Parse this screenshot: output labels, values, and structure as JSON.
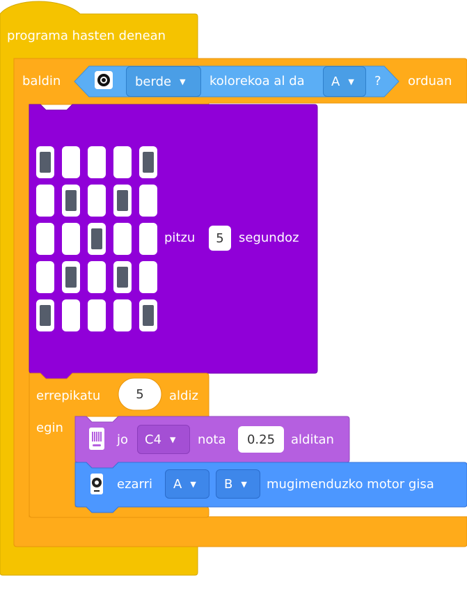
{
  "event_block": {
    "label": "programa hasten denean"
  },
  "if_block": {
    "label": "baldin",
    "then_label": "orduan",
    "condition": {
      "color": "berde",
      "text": "kolorekoa al da",
      "sensor": "A",
      "question_mark": "?"
    }
  },
  "matrix_block": {
    "label": "pitzu",
    "seconds": "5",
    "unit": "segundoz",
    "leds": [
      [
        1,
        0,
        0,
        0,
        1
      ],
      [
        0,
        1,
        0,
        1,
        0
      ],
      [
        0,
        0,
        1,
        0,
        0
      ],
      [
        0,
        1,
        0,
        1,
        0
      ],
      [
        1,
        0,
        0,
        0,
        1
      ]
    ]
  },
  "repeat_block": {
    "label": "errepikatu",
    "count": "5",
    "times": "aldiz",
    "do_label": "egin"
  },
  "note_block": {
    "play": "jo",
    "note": "C4",
    "note_label": "nota",
    "beats": "0.25",
    "beats_label": "alditan"
  },
  "motor_block": {
    "set": "ezarri",
    "port1": "A",
    "port2": "B",
    "text": "mugimenduzko motor gisa"
  },
  "colors": {
    "event": "#F5C300",
    "control": "#FFAB1A",
    "sensor": "#5BAEF5",
    "matrix": "#9000D8",
    "sound": "#B55FE0",
    "motor": "#4C97FF"
  }
}
